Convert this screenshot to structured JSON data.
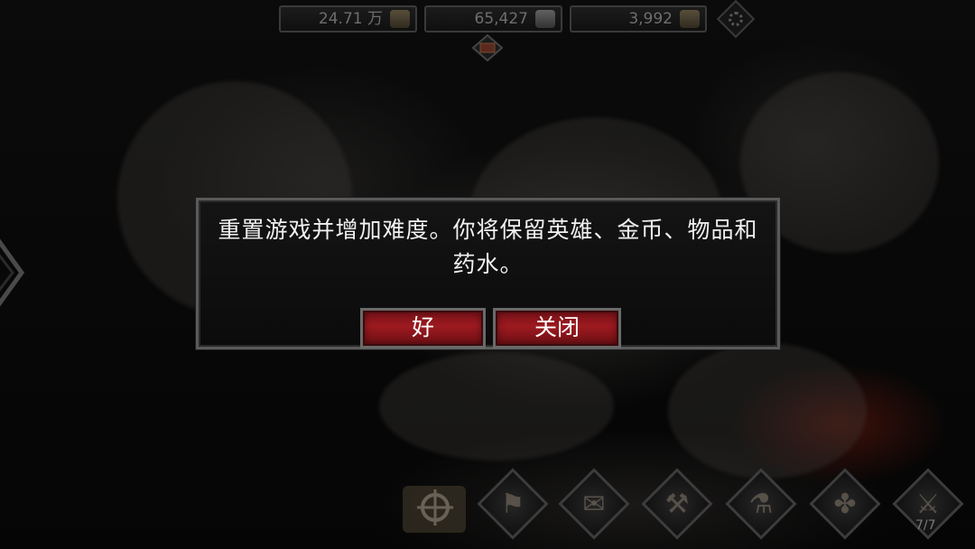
{
  "resources": {
    "gold": "24.71 万",
    "silver": "65,427",
    "gems": "3,992"
  },
  "icons": {
    "gold": "coin-stack-icon",
    "silver": "silver-pile-icon",
    "gems": "gold-bars-icon",
    "settings": "gear-icon",
    "menu": "scroll-menu-icon",
    "back": "left-arrow-icon"
  },
  "dialog": {
    "message": "重置游戏并增加难度。你将保留英雄、金币、物品和药水。",
    "ok_label": "好",
    "close_label": "关闭"
  },
  "action_bar": {
    "items": [
      {
        "name": "map-target-icon",
        "glyph": "✜"
      },
      {
        "name": "flag-icon",
        "glyph": "⚑"
      },
      {
        "name": "quest-scroll-icon",
        "glyph": "✉"
      },
      {
        "name": "anvil-icon",
        "glyph": "⚒"
      },
      {
        "name": "potion-pouch-icon",
        "glyph": "⚗"
      },
      {
        "name": "loot-bag-icon",
        "glyph": "✤"
      },
      {
        "name": "crossed-swords-icon",
        "glyph": "⚔"
      }
    ],
    "counter": "7/7"
  },
  "colors": {
    "button_red": "#9c1a20",
    "frame_gray": "#5a5a5a",
    "text": "#f1f1f1"
  }
}
